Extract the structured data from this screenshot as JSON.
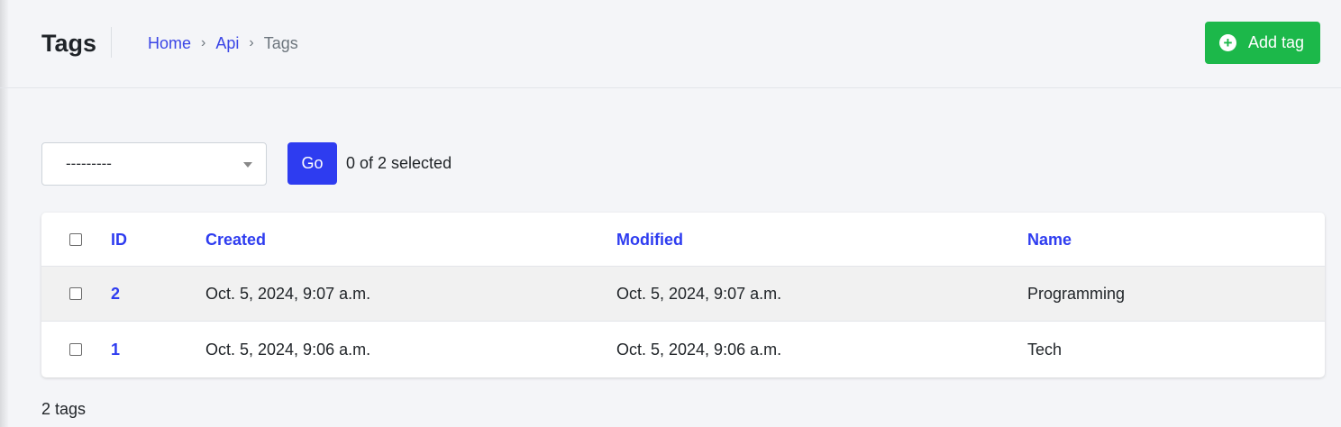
{
  "header": {
    "title": "Tags",
    "breadcrumb": [
      {
        "label": "Home"
      },
      {
        "label": "Api"
      },
      {
        "label": "Tags"
      }
    ],
    "breadcrumb_separator": "›",
    "add_button": {
      "label": "Add tag",
      "icon": "plus-circle-icon",
      "color": "#1cb84a"
    }
  },
  "actions": {
    "select_value": "---------",
    "go_label": "Go",
    "selected_text": "0 of 2 selected"
  },
  "table": {
    "columns": [
      "ID",
      "Created",
      "Modified",
      "Name"
    ],
    "rows": [
      {
        "id": "2",
        "created": "Oct. 5, 2024, 9:07 a.m.",
        "modified": "Oct. 5, 2024, 9:07 a.m.",
        "name": "Programming"
      },
      {
        "id": "1",
        "created": "Oct. 5, 2024, 9:06 a.m.",
        "modified": "Oct. 5, 2024, 9:06 a.m.",
        "name": "Tech"
      }
    ]
  },
  "footer": {
    "count_text": "2 tags"
  },
  "colors": {
    "accent": "#2e3cf0",
    "success": "#1cb84a",
    "background": "#f4f5f8"
  }
}
